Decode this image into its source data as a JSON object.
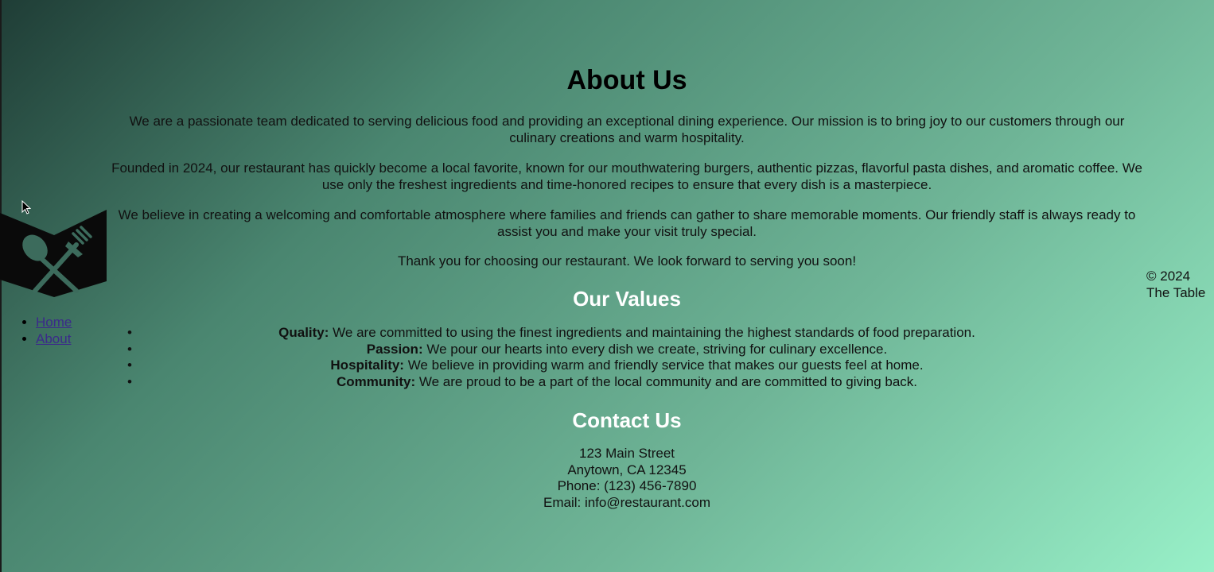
{
  "nav": {
    "items": [
      {
        "label": "Home"
      },
      {
        "label": "About"
      }
    ]
  },
  "logo": {
    "icon": "fork-spoon-book-icon"
  },
  "main": {
    "title": "About Us",
    "paragraphs": [
      "We are a passionate team dedicated to serving delicious food and providing an exceptional dining experience. Our mission is to bring joy to our customers through our culinary creations and warm hospitality.",
      "Founded in 2024, our restaurant has quickly become a local favorite, known for our mouthwatering burgers, authentic pizzas, flavorful pasta dishes, and aromatic coffee. We use only the freshest ingredients and time-honored recipes to ensure that every dish is a masterpiece.",
      "We believe in creating a welcoming and comfortable atmosphere where families and friends can gather to share memorable moments. Our friendly staff is always ready to assist you and make your visit truly special.",
      "Thank you for choosing our restaurant. We look forward to serving you soon!"
    ],
    "values_heading": "Our Values",
    "values": [
      {
        "term": "Quality:",
        "text": " We are committed to using the finest ingredients and maintaining the highest standards of food preparation."
      },
      {
        "term": "Passion:",
        "text": " We pour our hearts into every dish we create, striving for culinary excellence."
      },
      {
        "term": "Hospitality:",
        "text": " We believe in providing warm and friendly service that makes our guests feel at home."
      },
      {
        "term": "Community:",
        "text": " We are proud to be a part of the local community and are committed to giving back."
      }
    ],
    "contact_heading": "Contact Us",
    "contact": {
      "street": "123 Main Street",
      "city": "Anytown, CA 12345",
      "phone": "Phone: (123) 456-7890",
      "email": "Email: info@restaurant.com"
    }
  },
  "footer": {
    "line1": "© 2024",
    "line2": "The Table"
  },
  "colors": {
    "heading_white": "#ffffff",
    "link": "#3b2a8a",
    "gradient_start": "#1f3d36",
    "gradient_end": "#98f0c8"
  }
}
